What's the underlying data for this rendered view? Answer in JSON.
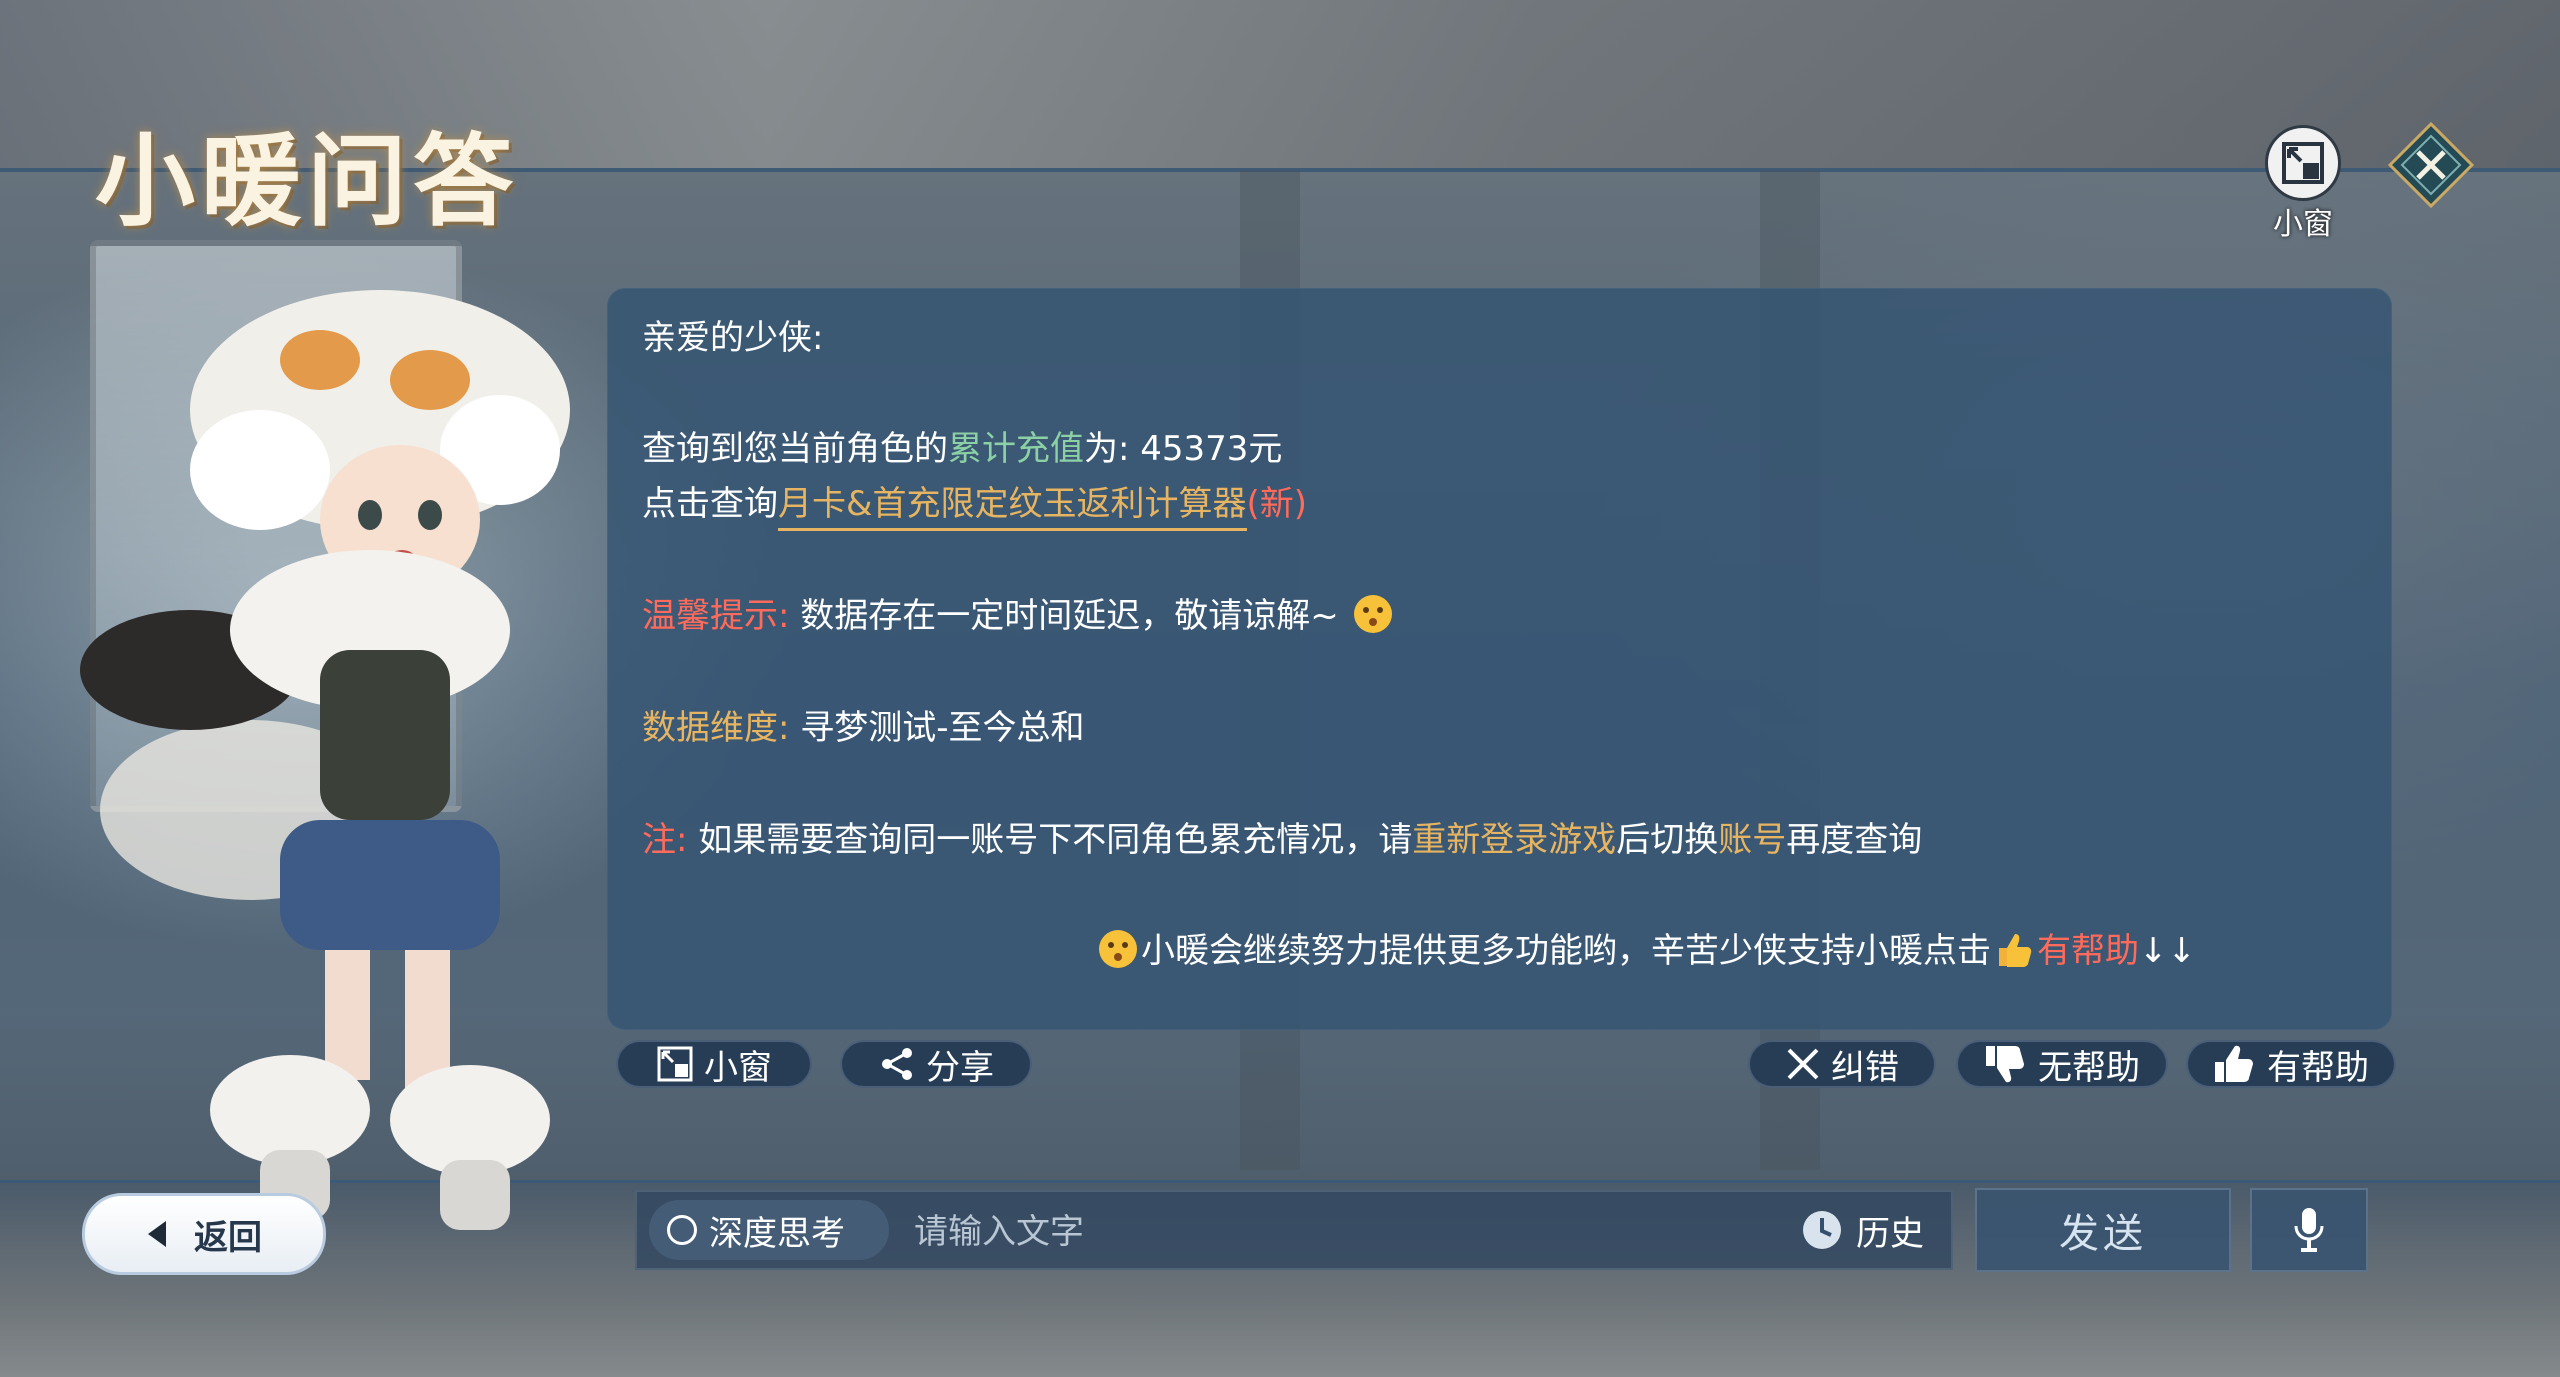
{
  "app": {
    "title": "小暖问答"
  },
  "top": {
    "mini_window_label": "小窗"
  },
  "panel": {
    "greeting": "亲爱的少侠:",
    "line1_prefix": "查询到您当前角色的",
    "line1_highlight": "累计充值",
    "line1_suffix": "为: 45373元",
    "line2_prefix": "点击查询",
    "line2_link": "月卡&首充限定纹玉返利计算器",
    "line2_new": "(新)",
    "tip_label": "温馨提示:",
    "tip_text": "数据存在一定时间延迟，敬请谅解~",
    "dimension_label": "数据维度:",
    "dimension_text": "寻梦测试-至今总和",
    "note_label": "注:",
    "note_text1": "如果需要查询同一账号下不同角色累充情况，请",
    "note_highlight1": "重新登录游戏",
    "note_text2": "后切换",
    "note_highlight2": "账号",
    "note_text3": "再度查询",
    "footer_text": "小暖会继续努力提供更多功能哟，辛苦少侠支持小暖点击",
    "footer_helpful": "有帮助",
    "footer_arrows": "↓↓"
  },
  "actions": {
    "mini_window": "小窗",
    "share": "分享",
    "correct": "纠错",
    "not_helpful": "无帮助",
    "helpful": "有帮助"
  },
  "bottom": {
    "back": "返回",
    "deep_think": "深度思考",
    "input_placeholder": "请输入文字",
    "input_value": "",
    "history": "历史",
    "send": "发送"
  },
  "colors": {
    "gold": "#e7b561",
    "green": "#8cd1a5",
    "red": "#ff6a5a",
    "panel": "#345473"
  },
  "icons": [
    "mini-window-icon",
    "close-icon",
    "share-icon",
    "x-icon",
    "thumbs-down-icon",
    "thumbs-up-icon",
    "back-arrow-icon",
    "clock-icon",
    "mic-icon",
    "surprised-emoji-icon",
    "thumbs-up-emoji-icon"
  ]
}
